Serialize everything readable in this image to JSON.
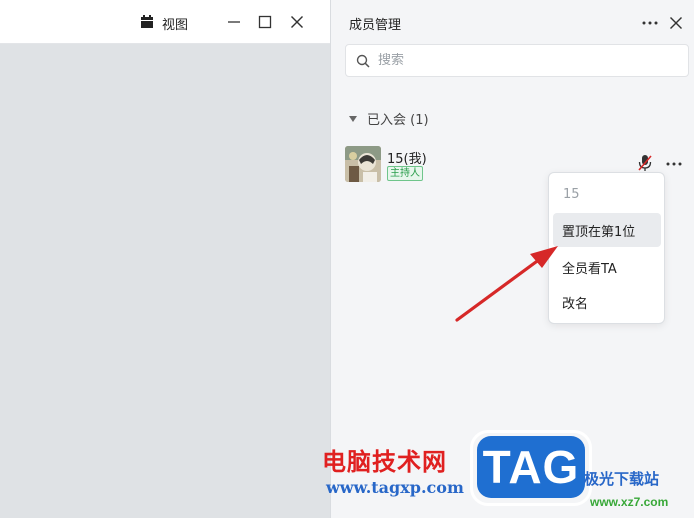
{
  "toolbar": {
    "view_label": "视图"
  },
  "panel": {
    "title": "成员管理",
    "search_placeholder": "搜索",
    "section_label": "已入会 (1)",
    "member": {
      "name": "15(我)",
      "badge": "主持人"
    }
  },
  "menu": {
    "header": "15",
    "items": [
      "置顶在第1位",
      "全员看TA",
      "改名"
    ]
  },
  "watermark": {
    "site_cn": "电脑技术网",
    "site_url": "www.tagxp.com",
    "logo": "TAG",
    "right_cn": "极光下载站",
    "right_url": "www.xz7.com"
  },
  "colors": {
    "accent_red": "#d62828",
    "badge_green": "#2a9d4b",
    "watermark_blue": "#1f6fd1"
  }
}
